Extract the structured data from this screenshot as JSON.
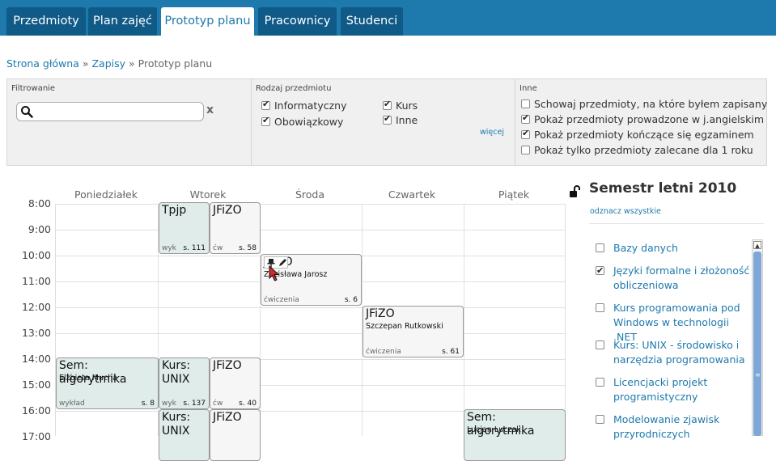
{
  "nav": {
    "tabs": [
      {
        "label": "Przedmioty",
        "active": false
      },
      {
        "label": "Plan zajęć",
        "active": false
      },
      {
        "label": "Prototyp planu",
        "active": true
      },
      {
        "label": "Pracownicy",
        "active": false
      },
      {
        "label": "Studenci",
        "active": false
      }
    ]
  },
  "breadcrumb": {
    "home": "Strona główna",
    "sep": "»",
    "enroll": "Zapisy",
    "current": "Prototyp planu"
  },
  "filters": {
    "search": {
      "title": "Filtrowanie",
      "value": "",
      "clear": "x"
    },
    "type": {
      "title": "Rodzaj przedmiotu",
      "options": [
        {
          "label": "Informatyczny",
          "checked": true
        },
        {
          "label": "Obowiązkowy",
          "checked": true
        },
        {
          "label": "Kurs",
          "checked": true
        },
        {
          "label": "Inne",
          "checked": true
        }
      ],
      "more": "więcej"
    },
    "other": {
      "title": "Inne",
      "options": [
        {
          "label": "Schowaj przedmioty, na które byłem zapisany",
          "checked": false
        },
        {
          "label": "Pokaż przedmioty prowadzone w j.angielskim",
          "checked": true
        },
        {
          "label": "Pokaż przedmioty kończące się egzaminem",
          "checked": true
        },
        {
          "label": "Pokaż tylko przedmioty zalecane dla 1 roku",
          "checked": false
        }
      ]
    }
  },
  "schedule": {
    "days": [
      "Poniedziałek",
      "Wtorek",
      "Środa",
      "Czwartek",
      "Piątek"
    ],
    "hours": [
      "8:00",
      "9:00",
      "10:00",
      "11:00",
      "12:00",
      "13:00",
      "14:00",
      "15:00",
      "16:00",
      "17:00"
    ],
    "blocks": [
      {
        "name": "Tpjp",
        "teacher": "",
        "type": "wyk",
        "room": "s. 111"
      },
      {
        "name": "JFiZO",
        "teacher": "",
        "type": "ćw",
        "room": "s. 58"
      },
      {
        "name": "JFiZO",
        "teacher": "Zdzisława Jarosz",
        "type": "ćwiczenia",
        "room": "s. 6"
      },
      {
        "name": "JFiZO",
        "teacher": "Szczepan Rutkowski",
        "type": "ćwiczenia",
        "room": "s. 61"
      },
      {
        "name": "Sem: algorytmika",
        "teacher": "Elżbieta Mucha",
        "type": "wykład",
        "room": "s. 8"
      },
      {
        "name": "Kurs: UNIX",
        "teacher": "",
        "type": "wyk",
        "room": "s. 137"
      },
      {
        "name": "JFiZO",
        "teacher": "",
        "type": "ćw",
        "room": "s. 40"
      },
      {
        "name": "Kurs: UNIX",
        "teacher": "",
        "type": "",
        "room": ""
      },
      {
        "name": "JFiZO",
        "teacher": "",
        "type": "",
        "room": ""
      },
      {
        "name": "Sem: algorytmika",
        "teacher": "Lucjan Łuczak",
        "type": "",
        "room": ""
      }
    ]
  },
  "semester": {
    "title": "Semestr letni 2010",
    "unselect_all": "odznacz wszystkie",
    "subjects": [
      {
        "label": "Bazy danych",
        "checked": false
      },
      {
        "label": "Języki formalne i złożoność obliczeniowa",
        "checked": true
      },
      {
        "label": "Kurs programowania pod Windows w technologii .NET",
        "checked": false
      },
      {
        "label": "Kurs: UNIX - środowisko i narzędzia programowania",
        "checked": false
      },
      {
        "label": "Licencjacki projekt programistyczny",
        "checked": false
      },
      {
        "label": "Modelowanie zjawisk przyrodniczych",
        "checked": false
      }
    ]
  },
  "colors": {
    "nav_bar": "#1e79ad",
    "nav_tab": "#105a87",
    "block_bg": "#dfecea",
    "link": "#1e79ad",
    "scroll_thumb": "#7ea6d6"
  },
  "icons": {
    "search": "search-icon",
    "lock": "lock-open-icon",
    "pin": "pin-icon",
    "edit": "pencil-icon",
    "cursor": "pointer-cursor-icon"
  }
}
